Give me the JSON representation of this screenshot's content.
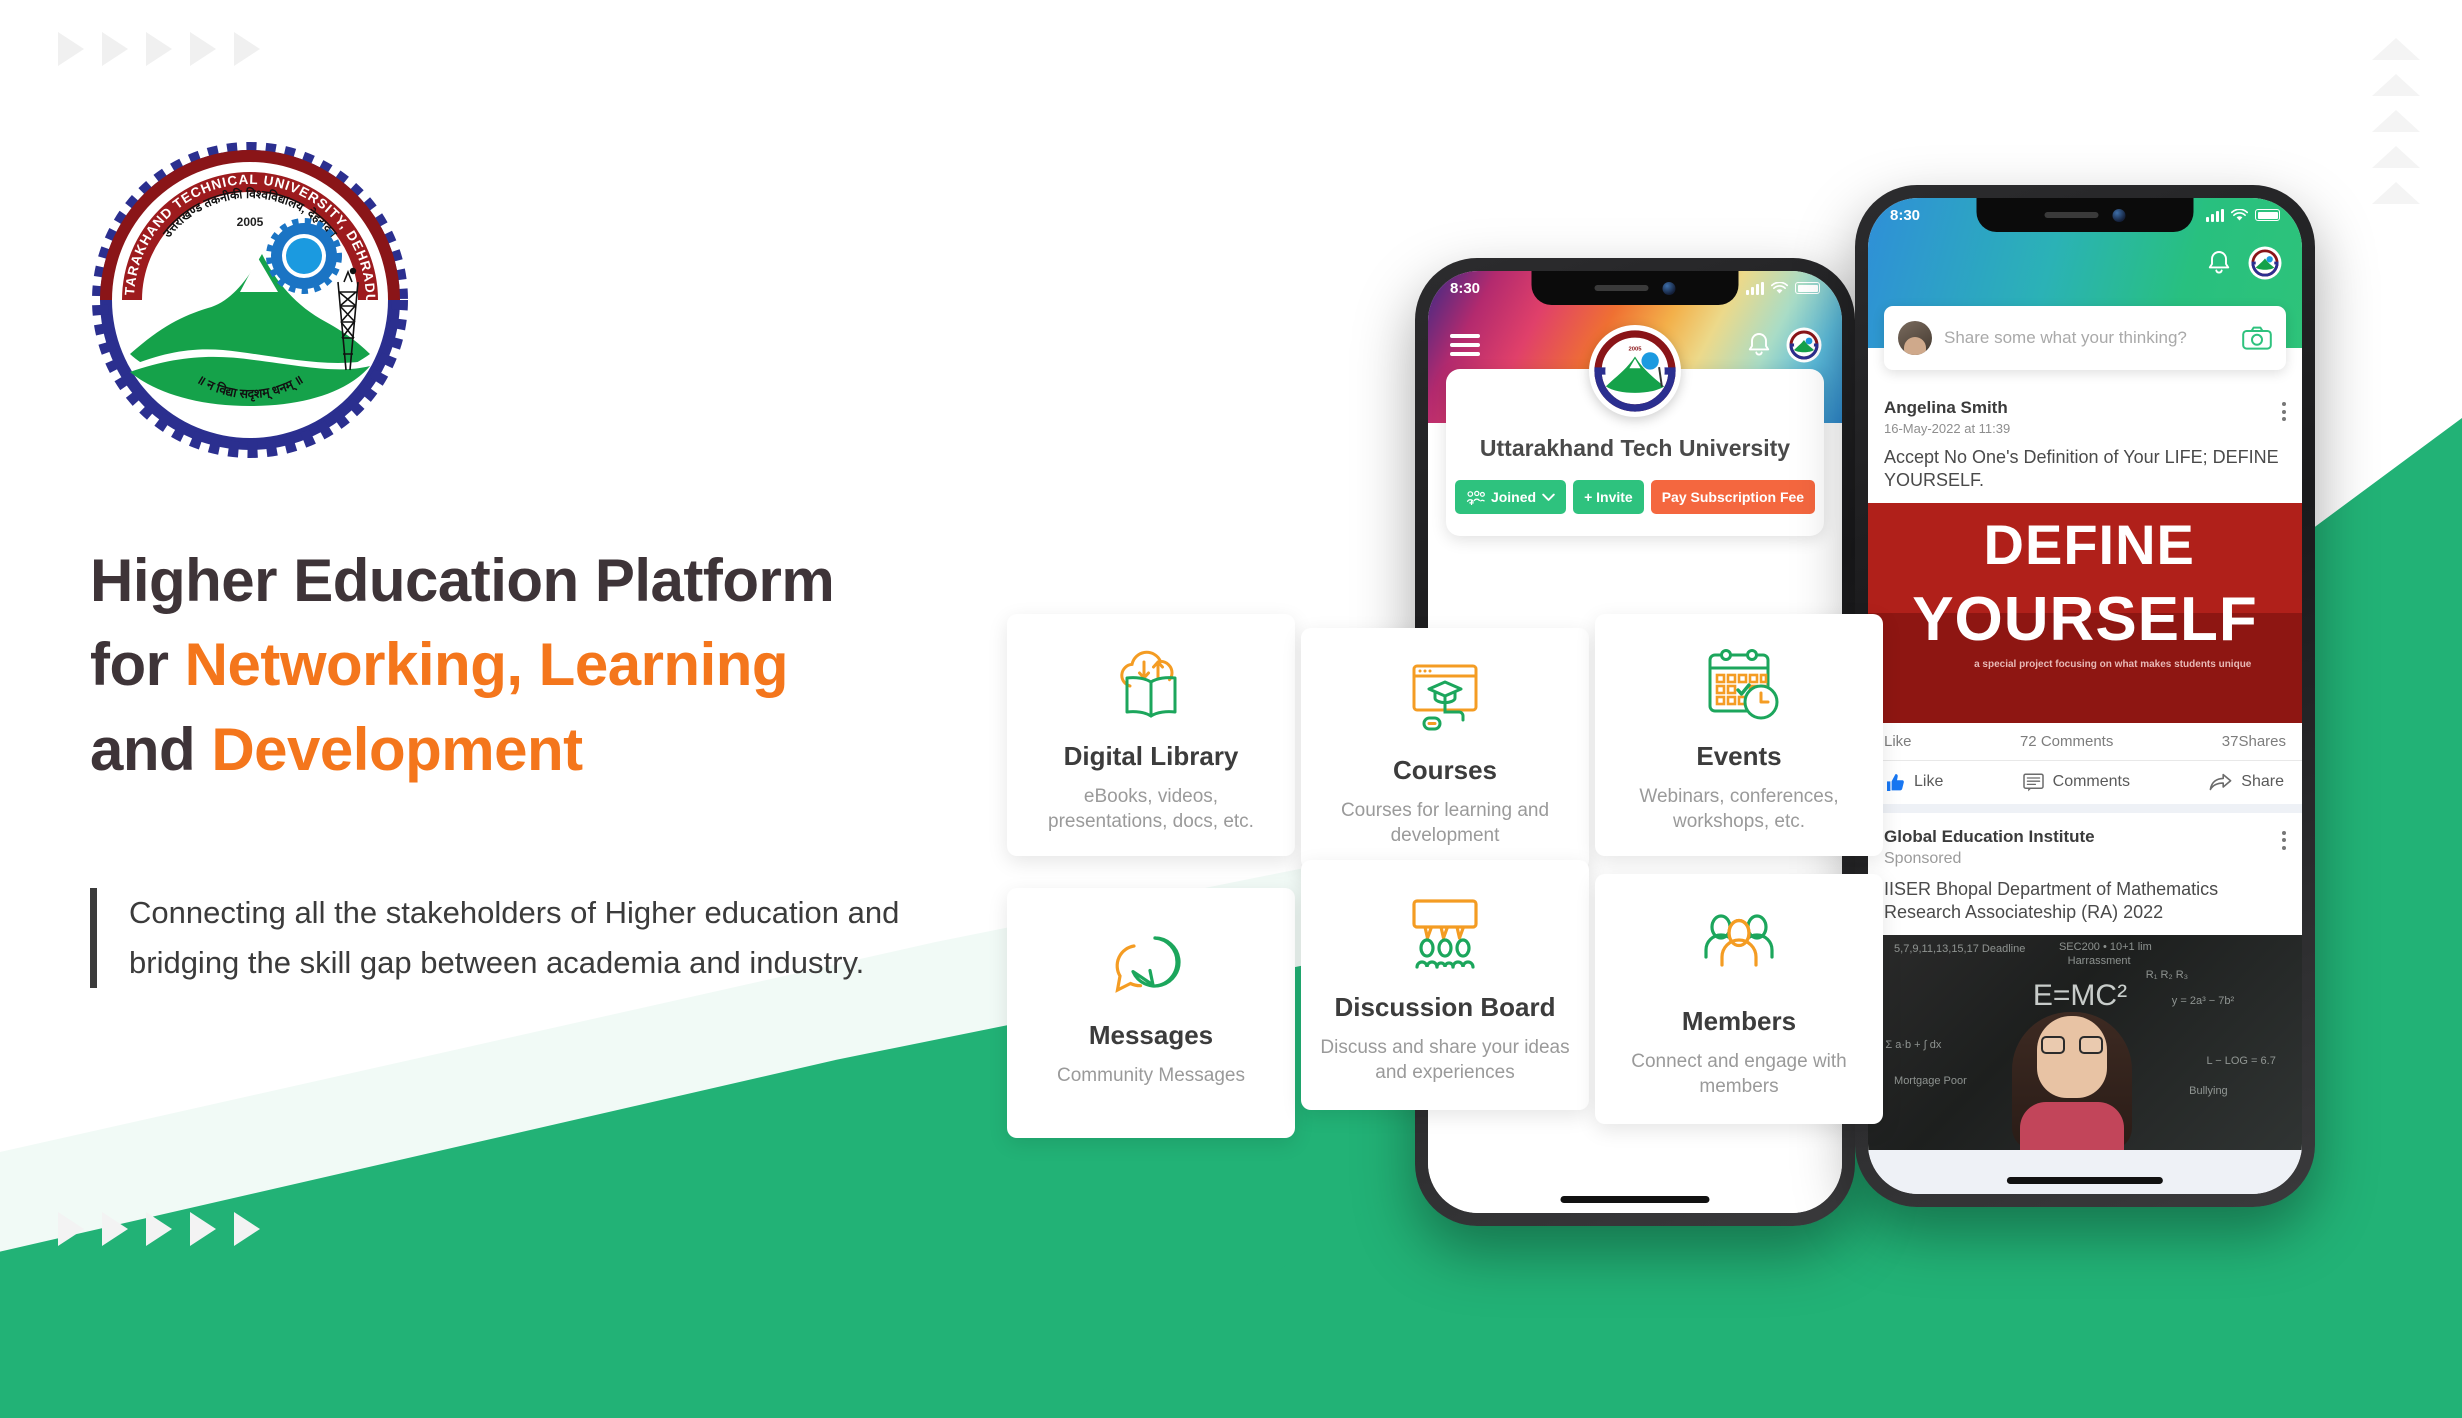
{
  "brand": {
    "logo_alt": "Uttarakhand Technical University Dehradun",
    "logo_ring_top": "UTTARAKHAND TECHNICAL UNIVERSITY, DEHRADUN",
    "logo_ring_bottom": "न विद्या सदृशम् धनम्",
    "logo_year": "2005",
    "accent_orange": "#f4761c",
    "accent_green": "#22b276",
    "headline_color": "#3e3438"
  },
  "hero": {
    "headline_line1_plain": "Higher Education Platform",
    "headline_line2_plain": "for ",
    "headline_line2_accent": "Networking, Learning",
    "headline_line3_plain": "and ",
    "headline_line3_accent": "Development",
    "quote": "Connecting all the stakeholders of Higher education and bridging the skill gap between academia and industry."
  },
  "features": [
    {
      "icon": "cloud-book-icon",
      "title": "Digital Library",
      "desc": "eBooks, videos, presentations, docs, etc."
    },
    {
      "icon": "browser-cap-icon",
      "title": "Courses",
      "desc": "Courses for learning and development"
    },
    {
      "icon": "calendar-clock-icon",
      "title": "Events",
      "desc": "Webinars, conferences, workshops, etc."
    },
    {
      "icon": "chat-bubbles-icon",
      "title": "Messages",
      "desc": "Community Messages"
    },
    {
      "icon": "board-people-icon",
      "title": "Discussion Board",
      "desc": "Discuss and share your ideas and experiences"
    },
    {
      "icon": "members-group-icon",
      "title": "Members",
      "desc": "Connect and engage with members"
    }
  ],
  "phone1": {
    "status_time": "8:30",
    "status_icons": [
      "signal-icon",
      "wifi-icon",
      "battery-icon"
    ],
    "menu_icon": "hamburger-menu-icon",
    "bell_icon": "bell-icon",
    "avatar_icon": "university-avatar-icon",
    "university_name": "Uttarakhand Tech University",
    "buttons": [
      {
        "label": "Joined",
        "icon": "group-add-icon",
        "chevron": "chevron-down-icon",
        "color": "green"
      },
      {
        "label": "+ Invite",
        "color": "green"
      },
      {
        "label": "Pay Subscription Fee",
        "color": "orange"
      }
    ]
  },
  "phone2": {
    "status_time": "8:30",
    "bell_icon": "bell-icon",
    "avatar_icon": "university-avatar-icon",
    "composer_placeholder": "Share some what your thinking?",
    "composer_camera_icon": "camera-icon",
    "posts": [
      {
        "author": "Angelina Smith",
        "time": "16-May-2022 at 11:39",
        "menu_icon": "kebab-menu-icon",
        "text": "Accept No One's Definition of Your LIFE; DEFINE YOURSELF.",
        "image": {
          "kind": "define-yourself-banner",
          "word1": "DEFINE",
          "word2": "YOURSELF",
          "tagline": "a special project focusing on what makes students unique"
        },
        "stats_like": "Like",
        "stats_comments": "72 Comments",
        "stats_shares": "37Shares",
        "actions": [
          {
            "label": "Like",
            "icon": "thumbs-up-icon"
          },
          {
            "label": "Comments",
            "icon": "comment-icon"
          },
          {
            "label": "Share",
            "icon": "share-arrow-icon"
          }
        ]
      },
      {
        "author": "Global Education Institute",
        "sub": "Sponsored",
        "menu_icon": "kebab-menu-icon",
        "text": "IISER Bhopal Department of Mathematics Research Associateship (RA) 2022",
        "image": {
          "kind": "chalkboard-student-photo"
        }
      }
    ]
  },
  "decor": {
    "triangle_right_icon": "triangle-right-icon",
    "triangle_up_icon": "triangle-up-icon",
    "top_left_count": 5,
    "bottom_left_count": 5,
    "right_count": 5
  }
}
